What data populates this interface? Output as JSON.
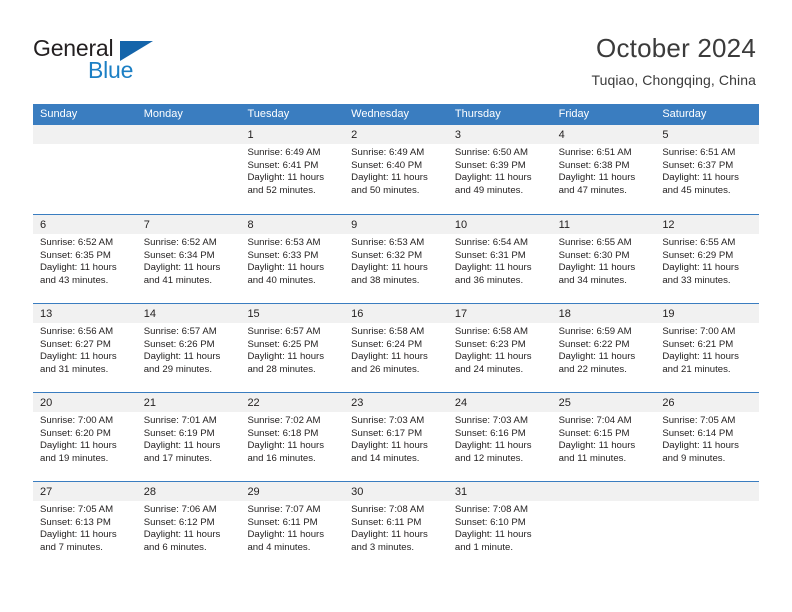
{
  "brand": {
    "name_part1": "General",
    "name_part2": "Blue",
    "mark_icon": "triangle-flag-icon",
    "color_primary": "#1464aa",
    "color_text": "#231f20"
  },
  "header": {
    "title": "October 2024",
    "subtitle": "Tuqiao, Chongqing, China"
  },
  "calendar": {
    "header_bg": "#3a7dc0",
    "day_band_bg": "#f1f1f1",
    "weekdays": [
      "Sunday",
      "Monday",
      "Tuesday",
      "Wednesday",
      "Thursday",
      "Friday",
      "Saturday"
    ],
    "weeks": [
      [
        {
          "day": "",
          "lines": []
        },
        {
          "day": "",
          "lines": []
        },
        {
          "day": "1",
          "lines": [
            "Sunrise: 6:49 AM",
            "Sunset: 6:41 PM",
            "Daylight: 11 hours",
            "and 52 minutes."
          ]
        },
        {
          "day": "2",
          "lines": [
            "Sunrise: 6:49 AM",
            "Sunset: 6:40 PM",
            "Daylight: 11 hours",
            "and 50 minutes."
          ]
        },
        {
          "day": "3",
          "lines": [
            "Sunrise: 6:50 AM",
            "Sunset: 6:39 PM",
            "Daylight: 11 hours",
            "and 49 minutes."
          ]
        },
        {
          "day": "4",
          "lines": [
            "Sunrise: 6:51 AM",
            "Sunset: 6:38 PM",
            "Daylight: 11 hours",
            "and 47 minutes."
          ]
        },
        {
          "day": "5",
          "lines": [
            "Sunrise: 6:51 AM",
            "Sunset: 6:37 PM",
            "Daylight: 11 hours",
            "and 45 minutes."
          ]
        }
      ],
      [
        {
          "day": "6",
          "lines": [
            "Sunrise: 6:52 AM",
            "Sunset: 6:35 PM",
            "Daylight: 11 hours",
            "and 43 minutes."
          ]
        },
        {
          "day": "7",
          "lines": [
            "Sunrise: 6:52 AM",
            "Sunset: 6:34 PM",
            "Daylight: 11 hours",
            "and 41 minutes."
          ]
        },
        {
          "day": "8",
          "lines": [
            "Sunrise: 6:53 AM",
            "Sunset: 6:33 PM",
            "Daylight: 11 hours",
            "and 40 minutes."
          ]
        },
        {
          "day": "9",
          "lines": [
            "Sunrise: 6:53 AM",
            "Sunset: 6:32 PM",
            "Daylight: 11 hours",
            "and 38 minutes."
          ]
        },
        {
          "day": "10",
          "lines": [
            "Sunrise: 6:54 AM",
            "Sunset: 6:31 PM",
            "Daylight: 11 hours",
            "and 36 minutes."
          ]
        },
        {
          "day": "11",
          "lines": [
            "Sunrise: 6:55 AM",
            "Sunset: 6:30 PM",
            "Daylight: 11 hours",
            "and 34 minutes."
          ]
        },
        {
          "day": "12",
          "lines": [
            "Sunrise: 6:55 AM",
            "Sunset: 6:29 PM",
            "Daylight: 11 hours",
            "and 33 minutes."
          ]
        }
      ],
      [
        {
          "day": "13",
          "lines": [
            "Sunrise: 6:56 AM",
            "Sunset: 6:27 PM",
            "Daylight: 11 hours",
            "and 31 minutes."
          ]
        },
        {
          "day": "14",
          "lines": [
            "Sunrise: 6:57 AM",
            "Sunset: 6:26 PM",
            "Daylight: 11 hours",
            "and 29 minutes."
          ]
        },
        {
          "day": "15",
          "lines": [
            "Sunrise: 6:57 AM",
            "Sunset: 6:25 PM",
            "Daylight: 11 hours",
            "and 28 minutes."
          ]
        },
        {
          "day": "16",
          "lines": [
            "Sunrise: 6:58 AM",
            "Sunset: 6:24 PM",
            "Daylight: 11 hours",
            "and 26 minutes."
          ]
        },
        {
          "day": "17",
          "lines": [
            "Sunrise: 6:58 AM",
            "Sunset: 6:23 PM",
            "Daylight: 11 hours",
            "and 24 minutes."
          ]
        },
        {
          "day": "18",
          "lines": [
            "Sunrise: 6:59 AM",
            "Sunset: 6:22 PM",
            "Daylight: 11 hours",
            "and 22 minutes."
          ]
        },
        {
          "day": "19",
          "lines": [
            "Sunrise: 7:00 AM",
            "Sunset: 6:21 PM",
            "Daylight: 11 hours",
            "and 21 minutes."
          ]
        }
      ],
      [
        {
          "day": "20",
          "lines": [
            "Sunrise: 7:00 AM",
            "Sunset: 6:20 PM",
            "Daylight: 11 hours",
            "and 19 minutes."
          ]
        },
        {
          "day": "21",
          "lines": [
            "Sunrise: 7:01 AM",
            "Sunset: 6:19 PM",
            "Daylight: 11 hours",
            "and 17 minutes."
          ]
        },
        {
          "day": "22",
          "lines": [
            "Sunrise: 7:02 AM",
            "Sunset: 6:18 PM",
            "Daylight: 11 hours",
            "and 16 minutes."
          ]
        },
        {
          "day": "23",
          "lines": [
            "Sunrise: 7:03 AM",
            "Sunset: 6:17 PM",
            "Daylight: 11 hours",
            "and 14 minutes."
          ]
        },
        {
          "day": "24",
          "lines": [
            "Sunrise: 7:03 AM",
            "Sunset: 6:16 PM",
            "Daylight: 11 hours",
            "and 12 minutes."
          ]
        },
        {
          "day": "25",
          "lines": [
            "Sunrise: 7:04 AM",
            "Sunset: 6:15 PM",
            "Daylight: 11 hours",
            "and 11 minutes."
          ]
        },
        {
          "day": "26",
          "lines": [
            "Sunrise: 7:05 AM",
            "Sunset: 6:14 PM",
            "Daylight: 11 hours",
            "and 9 minutes."
          ]
        }
      ],
      [
        {
          "day": "27",
          "lines": [
            "Sunrise: 7:05 AM",
            "Sunset: 6:13 PM",
            "Daylight: 11 hours",
            "and 7 minutes."
          ]
        },
        {
          "day": "28",
          "lines": [
            "Sunrise: 7:06 AM",
            "Sunset: 6:12 PM",
            "Daylight: 11 hours",
            "and 6 minutes."
          ]
        },
        {
          "day": "29",
          "lines": [
            "Sunrise: 7:07 AM",
            "Sunset: 6:11 PM",
            "Daylight: 11 hours",
            "and 4 minutes."
          ]
        },
        {
          "day": "30",
          "lines": [
            "Sunrise: 7:08 AM",
            "Sunset: 6:11 PM",
            "Daylight: 11 hours",
            "and 3 minutes."
          ]
        },
        {
          "day": "31",
          "lines": [
            "Sunrise: 7:08 AM",
            "Sunset: 6:10 PM",
            "Daylight: 11 hours",
            "and 1 minute."
          ]
        },
        {
          "day": "",
          "lines": []
        },
        {
          "day": "",
          "lines": []
        }
      ]
    ]
  }
}
